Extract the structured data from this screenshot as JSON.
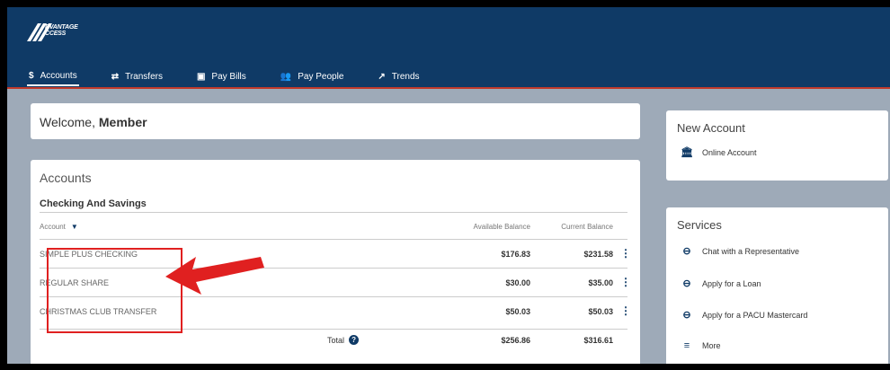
{
  "brand": {
    "logo_line1": "DVANTAGE",
    "logo_line2": "CCESS"
  },
  "nav": [
    {
      "icon": "$",
      "label": "Accounts"
    },
    {
      "icon": "⇄",
      "label": "Transfers"
    },
    {
      "icon": "▣",
      "label": "Pay Bills"
    },
    {
      "icon": "👥",
      "label": "Pay People"
    },
    {
      "icon": "↗",
      "label": "Trends"
    }
  ],
  "welcome": {
    "greeting": "Welcome,",
    "name": "Member"
  },
  "accounts": {
    "title": "Accounts",
    "group": "Checking And Savings",
    "columns": {
      "account": "Account",
      "available": "Available Balance",
      "current": "Current Balance"
    },
    "rows": [
      {
        "name": "SIMPLE PLUS CHECKING",
        "available": "$176.83",
        "current": "$231.58"
      },
      {
        "name": "REGULAR SHARE",
        "available": "$30.00",
        "current": "$35.00"
      },
      {
        "name": "CHRISTMAS CLUB TRANSFER",
        "available": "$50.03",
        "current": "$50.03"
      }
    ],
    "total": {
      "label": "Total",
      "available": "$256.86",
      "current": "$316.61"
    }
  },
  "new_account": {
    "title": "New Account",
    "items": [
      {
        "icon": "bank-icon",
        "label": "Online Account"
      }
    ]
  },
  "services": {
    "title": "Services",
    "items": [
      {
        "icon": "link-icon",
        "label": "Chat with a Representative"
      },
      {
        "icon": "link-icon",
        "label": "Apply for a Loan"
      },
      {
        "icon": "link-icon",
        "label": "Apply for a PACU Mastercard"
      },
      {
        "icon": "menu-icon",
        "label": "More"
      }
    ]
  },
  "colors": {
    "header": "#0f3a66",
    "accent_line": "#c0392b",
    "annotation": "#e02020"
  }
}
